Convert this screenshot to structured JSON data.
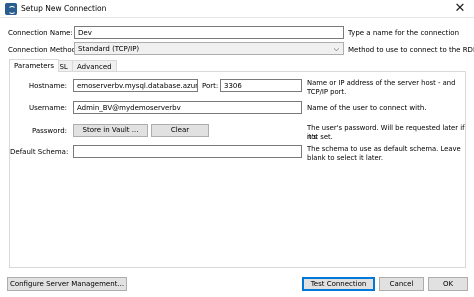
{
  "window": {
    "title": "Setup New Connection",
    "close_glyph": "✕"
  },
  "connection": {
    "name_label": "Connection Name:",
    "name_value": "Dev",
    "name_hint": "Type a name for the connection",
    "method_label": "Connection Method:",
    "method_value": "Standard (TCP/IP)",
    "method_hint": "Method to use to connect to the RDBMS"
  },
  "tabs": [
    {
      "label": "Parameters",
      "active": true
    },
    {
      "label": "SSL",
      "active": false
    },
    {
      "label": "Advanced",
      "active": false
    }
  ],
  "parameters": {
    "hostname_label": "Hostname:",
    "hostname_value": "emoserverbv.mysql.database.azure.com",
    "port_label": "Port:",
    "port_value": "3306",
    "hostname_hint_1": "Name or IP address of the server host - and",
    "hostname_hint_2": "TCP/IP port.",
    "username_label": "Username:",
    "username_value": "Admin_BV@mydemoserverbv",
    "username_hint": "Name of the user to connect with.",
    "password_label": "Password:",
    "store_vault_label": "Store in Vault ...",
    "clear_label": "Clear",
    "password_hint_1": "The user's password. Will be requested later if it's",
    "password_hint_2": "not set.",
    "schema_label": "Default Schema:",
    "schema_value": "",
    "schema_hint_1": "The schema to use as default schema. Leave",
    "schema_hint_2": "blank to select it later."
  },
  "footer": {
    "configure_label": "Configure Server Management...",
    "test_label": "Test Connection",
    "cancel_label": "Cancel",
    "ok_label": "OK"
  },
  "icons": {
    "app": "mysql-workbench-icon",
    "close": "close-icon",
    "dropdown": "chevron-down-icon"
  }
}
